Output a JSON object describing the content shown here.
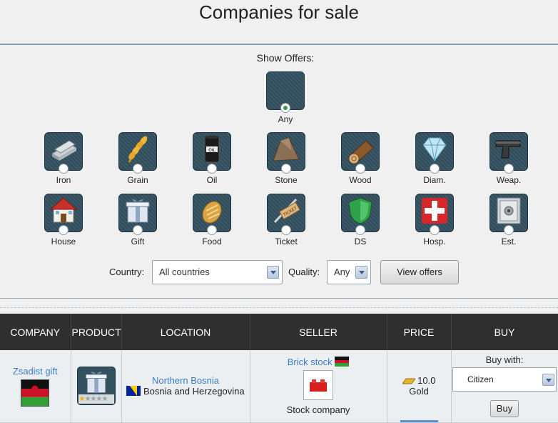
{
  "page": {
    "title": "Companies for sale"
  },
  "filters": {
    "show_offers_label": "Show Offers:",
    "any_label": "Any",
    "products": [
      {
        "label": "Iron",
        "icon": "iron-icon"
      },
      {
        "label": "Grain",
        "icon": "grain-icon"
      },
      {
        "label": "Oil",
        "icon": "oil-icon"
      },
      {
        "label": "Stone",
        "icon": "stone-icon"
      },
      {
        "label": "Wood",
        "icon": "wood-icon"
      },
      {
        "label": "Diam.",
        "icon": "diamond-icon"
      },
      {
        "label": "Weap.",
        "icon": "weapon-icon"
      },
      {
        "label": "House",
        "icon": "house-icon"
      },
      {
        "label": "Gift",
        "icon": "gift-icon"
      },
      {
        "label": "Food",
        "icon": "food-icon"
      },
      {
        "label": "Ticket",
        "icon": "ticket-icon"
      },
      {
        "label": "DS",
        "icon": "shield-icon"
      },
      {
        "label": "Hosp.",
        "icon": "hospital-icon"
      },
      {
        "label": "Est.",
        "icon": "safe-icon"
      }
    ],
    "country_label": "Country:",
    "country_value": "All countries",
    "quality_label": "Quality:",
    "quality_value": "Any",
    "view_button": "View offers"
  },
  "table": {
    "headers": [
      "COMPANY",
      "PRODUCT",
      "LOCATION",
      "SELLER",
      "PRICE",
      "BUY"
    ],
    "rows": [
      {
        "company": "Zsadist gift",
        "product_quality_stars": 1,
        "product_quality_max": 5,
        "location_region": "Northern Bosnia",
        "location_country": "Bosnia and Herzegovina",
        "seller_name": "Brick stock",
        "seller_type": "Stock company",
        "price_value": "10.0",
        "price_currency": "Gold",
        "buy_with_label": "Buy with:",
        "buy_with_value": "Citizen",
        "buy_button": "Buy"
      }
    ]
  },
  "colors": {
    "tile_bg": "#33505f",
    "header_bg": "#2f2f2f",
    "link": "#3a7cc4"
  }
}
